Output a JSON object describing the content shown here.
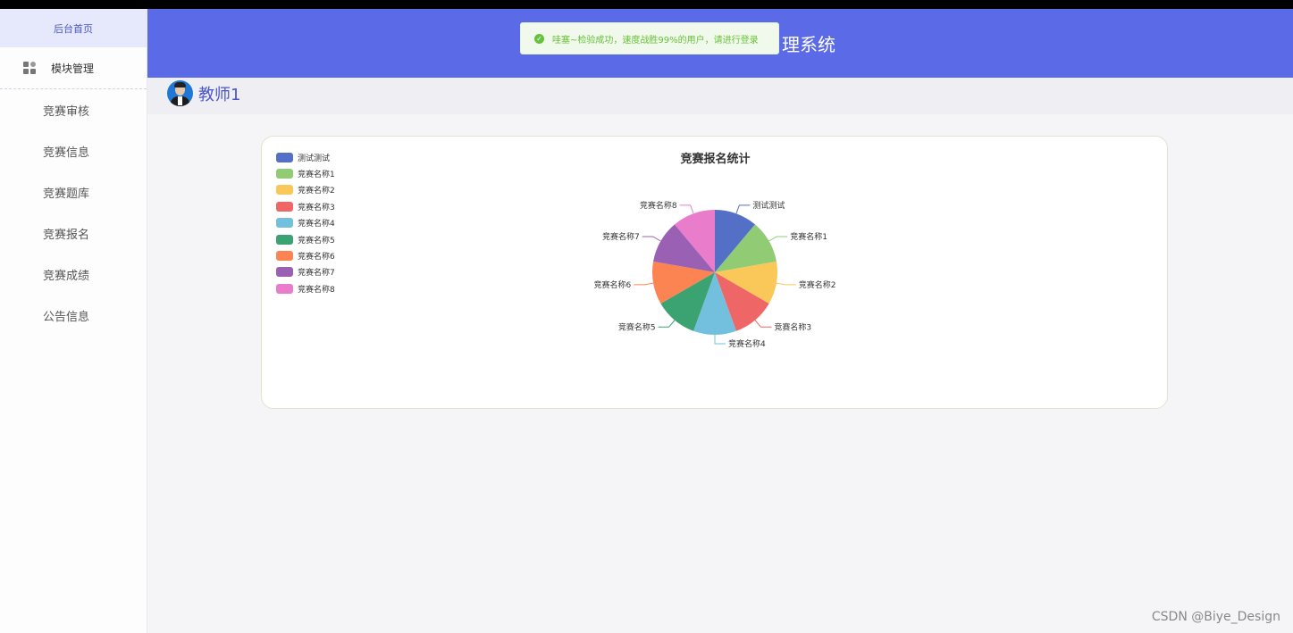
{
  "sidebar": {
    "home_label": "后台首页",
    "module_label": "模块管理",
    "items": [
      {
        "label": "竞赛审核"
      },
      {
        "label": "竞赛信息"
      },
      {
        "label": "竞赛题库"
      },
      {
        "label": "竞赛报名"
      },
      {
        "label": "竞赛成绩"
      },
      {
        "label": "公告信息"
      }
    ]
  },
  "header": {
    "title_visible": "理系统",
    "toast_message": "哇塞~检验成功，速度战胜99%的用户，请进行登录"
  },
  "user": {
    "name": "教师1"
  },
  "chart_data": {
    "type": "pie",
    "title": "竞赛报名统计",
    "legend_position": "top-left",
    "slices": [
      {
        "name": "测试测试",
        "value": 1,
        "color": "#5470c6"
      },
      {
        "name": "竞赛名称1",
        "value": 1,
        "color": "#91cc75"
      },
      {
        "name": "竞赛名称2",
        "value": 1,
        "color": "#fac858"
      },
      {
        "name": "竞赛名称3",
        "value": 1,
        "color": "#ee6666"
      },
      {
        "name": "竞赛名称4",
        "value": 1,
        "color": "#73c0de"
      },
      {
        "name": "竞赛名称5",
        "value": 1,
        "color": "#3ba272"
      },
      {
        "name": "竞赛名称6",
        "value": 1,
        "color": "#fc8452"
      },
      {
        "name": "竞赛名称7",
        "value": 1,
        "color": "#9a60b4"
      },
      {
        "name": "竞赛名称8",
        "value": 1,
        "color": "#ea7ccc"
      }
    ]
  },
  "watermark": "CSDN @Biye_Design"
}
